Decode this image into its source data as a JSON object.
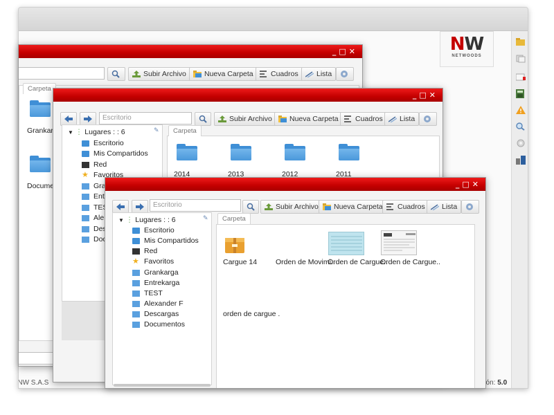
{
  "app": {
    "logo_text": "NW",
    "logo_sub": "NETWOODS",
    "footer_left": "NW S.A.S",
    "footer_version_label": "rsión:",
    "footer_version_value": "5.0",
    "sidebar_icons": [
      "folder-open-icon",
      "copy-icon",
      "mail-icon",
      "calculator-icon",
      "warning-icon",
      "search-icon",
      "gear-icon",
      "user-lock-icon"
    ]
  },
  "win1": {
    "controls": [
      "_",
      "□",
      "✕"
    ],
    "toolbar": {
      "upload": "Subir Archivo",
      "new_folder": "Nueva Carpeta",
      "grid": "Cuadros",
      "list": "Lista"
    },
    "tab": "Carpeta",
    "folders": [
      "Grankarga",
      "Documen"
    ]
  },
  "win2": {
    "controls": [
      "_",
      "□",
      "✕"
    ],
    "search_placeholder": "Escritorio",
    "toolbar": {
      "upload": "Subir Archivo",
      "new_folder": "Nueva Carpeta",
      "grid": "Cuadros",
      "list": "Lista"
    },
    "tree": {
      "root": "Lugares : : 6",
      "items": [
        "Escritorio",
        "Mis Compartidos",
        "Red",
        "Favoritos",
        "Gra",
        "Entr",
        "TES",
        "Ale",
        "Des",
        "Doc"
      ]
    },
    "tab": "Carpeta",
    "folders": [
      "2014",
      "2013",
      "2012",
      "2011"
    ]
  },
  "win3": {
    "controls": [
      "_",
      "□",
      "✕"
    ],
    "search_placeholder": "Escritorio",
    "toolbar": {
      "upload": "Subir Archivo",
      "new_folder": "Nueva Carpeta",
      "grid": "Cuadros",
      "list": "Lista"
    },
    "tree": {
      "root": "Lugares : : 6",
      "items": [
        "Escritorio",
        "Mis Compartidos",
        "Red",
        "Favoritos",
        "Grankarga",
        "Entrekarga",
        "TEST",
        "Alexander F",
        "Descargas",
        "Documentos"
      ]
    },
    "tab": "Carpeta",
    "files": [
      "Cargue 14",
      "Orden de Movimi..",
      "Orden de Cargue..",
      "Orden de Cargue.."
    ],
    "extra_file": "orden de cargue ."
  },
  "colors": {
    "title_red": "#c40000",
    "folder_blue": "#3f8fd6"
  }
}
